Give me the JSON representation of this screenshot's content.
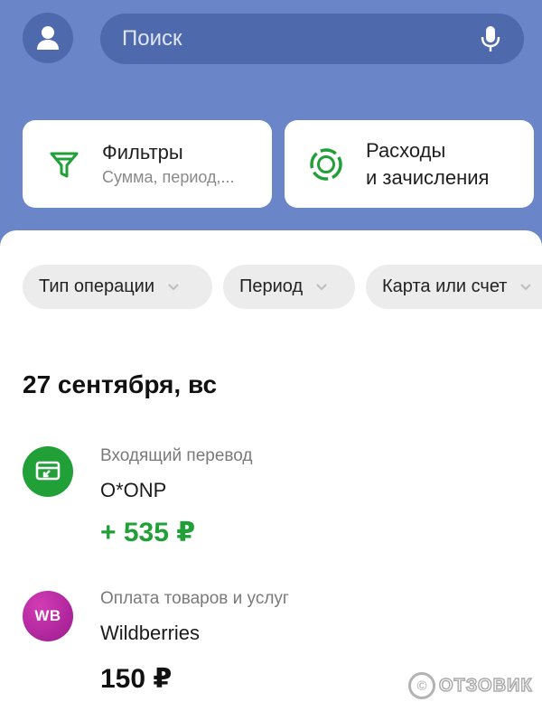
{
  "header": {
    "search": {
      "placeholder": "Поиск"
    }
  },
  "cards": {
    "filters": {
      "title": "Фильтры",
      "subtitle": "Сумма, период,..."
    },
    "expenses": {
      "title_line1": "Расходы",
      "title_line2": "и зачисления"
    }
  },
  "chips": [
    {
      "label": "Тип операции"
    },
    {
      "label": "Период"
    },
    {
      "label": "Карта или счет"
    }
  ],
  "date_header": "27 сентября, вс",
  "operations": [
    {
      "type": "Входящий перевод",
      "name": "O*ONP",
      "amount": "+ 535 ₽",
      "icon": "transfer-in-icon",
      "color": "#21a038"
    },
    {
      "type": "Оплата товаров и услуг",
      "name": "Wildberries",
      "amount": "150 ₽",
      "icon": "wildberries-logo",
      "logo_text": "WB",
      "color": "#a4228f"
    }
  ],
  "watermark": {
    "text": "ОТЗОВИК"
  },
  "colors": {
    "header_bg": "#6a86c9",
    "search_bg": "#4e6aad",
    "accent_green": "#21a038",
    "chip_bg": "#ececec"
  }
}
